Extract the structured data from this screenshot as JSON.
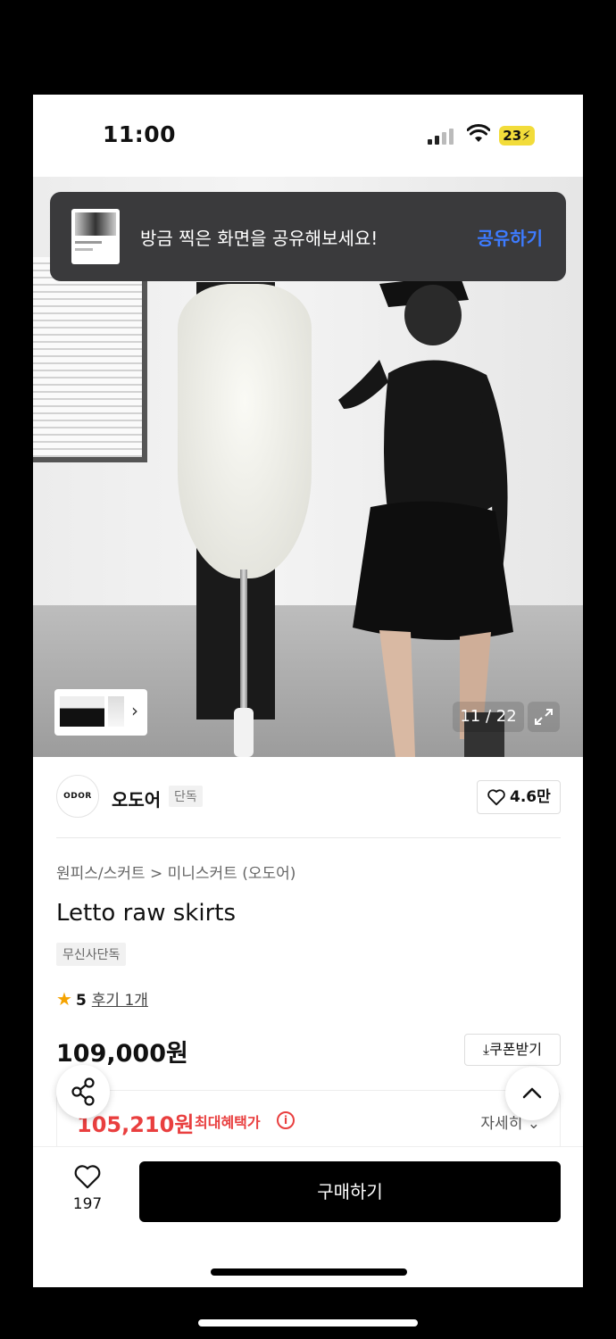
{
  "status_bar": {
    "time": "11:00",
    "battery": "23"
  },
  "toast": {
    "message": "방금 찍은 화면을 공유해보세요!",
    "action": "공유하기"
  },
  "gallery": {
    "counter": "11 / 22"
  },
  "brand": {
    "logo_text": "ODOR",
    "name": "오도어",
    "badge": "단독",
    "likes": "4.6만"
  },
  "product": {
    "breadcrumb": "원피스/스커트 > 미니스커트 (오도어)",
    "title": "Letto raw skirts",
    "exclusive_badge": "무신사단독",
    "rating": "5",
    "review_link": "후기 1개",
    "price": "109,000원",
    "coupon_label": "쿠폰받기"
  },
  "benefit": {
    "price": "105,210원",
    "label": "최대혜택가",
    "detail": "자세히"
  },
  "bottom_bar": {
    "wish_count": "197",
    "buy_label": "구매하기"
  },
  "icons": {
    "wifi": "wifi-icon",
    "signal": "cellular-signal-icon",
    "expand": "expand-icon",
    "heart": "heart-outline-icon",
    "star": "star-filled-icon",
    "share": "share-icon",
    "chevron_up": "chevron-up-icon",
    "download": "download-icon",
    "info": "info-icon"
  },
  "colors": {
    "toast_bg": "#3a3a3c",
    "toast_action": "#3d7bff",
    "benefit": "#e93f3f",
    "star": "#f5a300",
    "buy_button": "#000000",
    "battery": "#f2dc3a"
  }
}
